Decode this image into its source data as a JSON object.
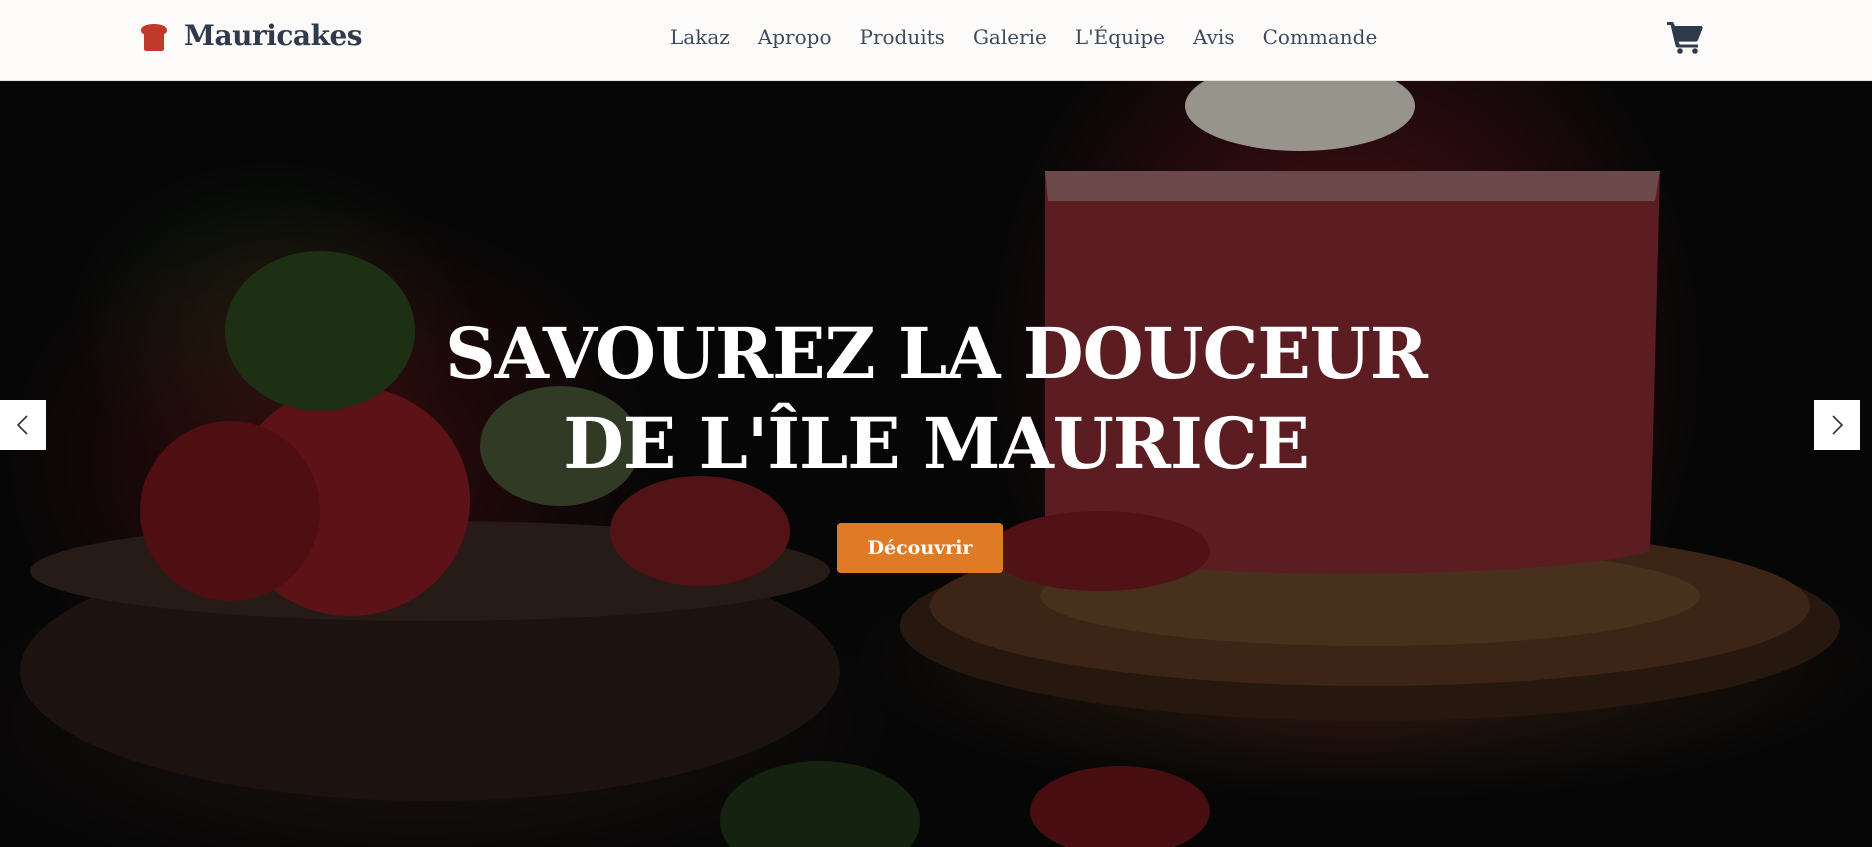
{
  "brand": {
    "name": "Mauricakes",
    "icon": "bread-icon",
    "icon_color": "#c0392b"
  },
  "nav": {
    "links": [
      "Lakaz",
      "Apropo",
      "Produits",
      "Galerie",
      "L'Équipe",
      "Avis",
      "Commande"
    ]
  },
  "cart": {
    "icon": "shopping-cart-icon"
  },
  "hero": {
    "title_line1": "SAVOUREZ LA DOUCEUR",
    "title_line2": "DE L'ÎLE MAURICE",
    "cta_label": "Découvrir",
    "cta_color": "#e07b25",
    "prev_icon": "chevron-left-icon",
    "next_icon": "chevron-right-icon"
  },
  "colors": {
    "nav_bg": "#fdfbf9",
    "nav_text": "#3d4a5c",
    "brand_text": "#2f3a4d"
  }
}
